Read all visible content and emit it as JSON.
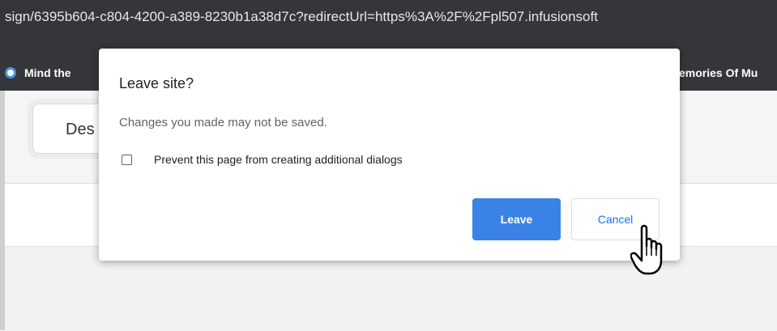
{
  "browser": {
    "url_text": "sign/6395b604-c804-4200-a389-8230b1a38d7c?redirectUrl=https%3A%2F%2Fpl507.infusionsoft",
    "bookmarks": {
      "left_label": "Mind the",
      "right_label": "emories Of Mu"
    }
  },
  "page": {
    "tab_label": "Des"
  },
  "dialog": {
    "title": "Leave site?",
    "message": "Changes you made may not be saved.",
    "checkbox_label": "Prevent this page from creating additional dialogs",
    "checkbox_checked": false,
    "leave_label": "Leave",
    "cancel_label": "Cancel",
    "primary_color": "#3b82e6",
    "link_color": "#1a73e8"
  },
  "cursor": {
    "type": "hand-pointer-icon"
  }
}
